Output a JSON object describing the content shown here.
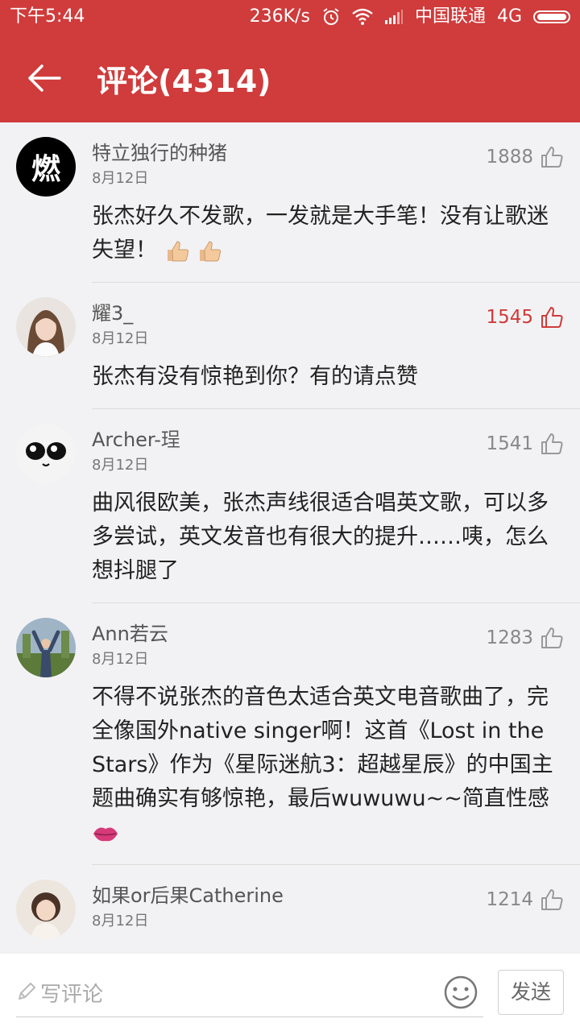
{
  "status": {
    "time": "下午5:44",
    "speed": "236K/s",
    "carrier": "中国联通",
    "network": "4G"
  },
  "header": {
    "title": "评论(4314)"
  },
  "comments": [
    {
      "name": "特立独行的种猪",
      "date": "8月12日",
      "likes": "1888",
      "liked": false,
      "text": "张杰好久不发歌，一发就是大手笔！没有让歌迷失望！",
      "avatar_char": "燃"
    },
    {
      "name": "耀3_",
      "date": "8月12日",
      "likes": "1545",
      "liked": true,
      "text": "张杰有没有惊艳到你？有的请点赞"
    },
    {
      "name": "Archer-珵",
      "date": "8月12日",
      "likes": "1541",
      "liked": false,
      "text": "曲风很欧美，张杰声线很适合唱英文歌，可以多多尝试，英文发音也有很大的提升……咦，怎么想抖腿了"
    },
    {
      "name": "Ann若云",
      "date": "8月12日",
      "likes": "1283",
      "liked": false,
      "text": "不得不说张杰的音色太适合英文电音歌曲了，完全像国外native singer啊！这首《Lost in the Stars》作为《星际迷航3：超越星辰》的中国主题曲确实有够惊艳，最后wuwuwu~~简直性感"
    },
    {
      "name": "如果or后果Catherine",
      "date": "8月12日",
      "likes": "1214",
      "liked": false,
      "text": ""
    }
  ],
  "composer": {
    "placeholder": "写评论",
    "send_label": "发送"
  },
  "colors": {
    "brand_red": "#d03b3b",
    "background": "#f2f2f4"
  }
}
